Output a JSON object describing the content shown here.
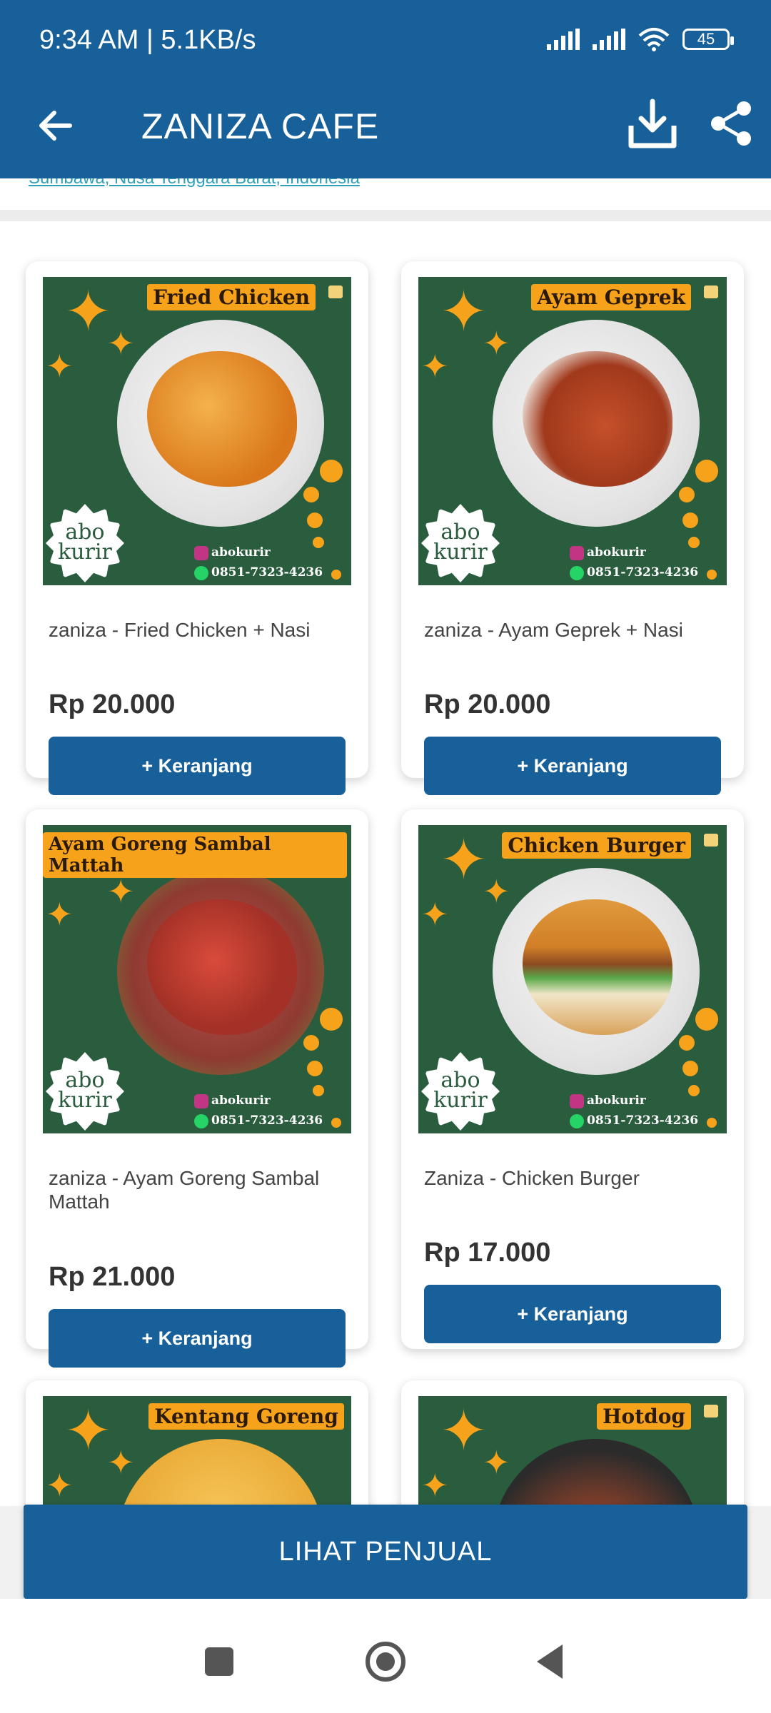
{
  "status_bar": {
    "time_network": "9:34 AM | 5.1KB/s",
    "battery": "45"
  },
  "app_bar": {
    "title": "ZANIZA CAFE",
    "back_icon": "arrow-left-icon",
    "download_icon": "download-icon",
    "share_icon": "share-icon"
  },
  "shop_info": {
    "address_partial": "Sumbawa, Nusa Tenggara Barat, Indonesia"
  },
  "products": [
    {
      "image_banner": "Fried Chicken",
      "name": "zaniza - Fried Chicken + Nasi",
      "price": "Rp 20.000",
      "add_label": "+ Keranjang"
    },
    {
      "image_banner": "Ayam Geprek",
      "name": "zaniza - Ayam Geprek + Nasi",
      "price": "Rp 20.000",
      "add_label": "+ Keranjang"
    },
    {
      "image_banner": "Ayam Goreng Sambal Mattah",
      "name": "zaniza - Ayam Goreng Sambal Mattah",
      "price": "Rp 21.000",
      "add_label": "+ Keranjang"
    },
    {
      "image_banner": "Chicken Burger",
      "name": "Zaniza - Chicken Burger",
      "price": "Rp 17.000",
      "add_label": "+ Keranjang"
    },
    {
      "image_banner": "Kentang Goreng"
    },
    {
      "image_banner": "Hotdog"
    }
  ],
  "image_watermark": {
    "badge": "abo kurir",
    "instagram": "abokurir",
    "whatsapp": "0851-7323-4236"
  },
  "cta": {
    "label": "LIHAT PENJUAL"
  },
  "nav": {
    "recents_icon": "square-icon",
    "home_icon": "circle-home-icon",
    "back_icon": "triangle-back-icon"
  }
}
